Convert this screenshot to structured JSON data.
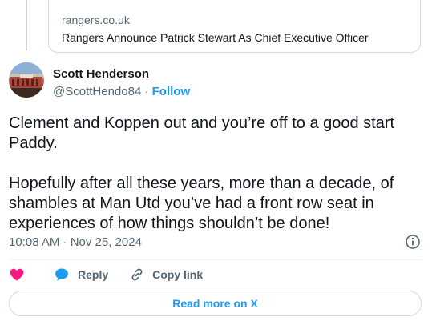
{
  "quoted_card": {
    "domain": "rangers.co.uk",
    "title": "Rangers Announce Patrick Stewart As Chief Executive Officer"
  },
  "author": {
    "name": "Scott Henderson",
    "handle": "@ScottHendo84",
    "separator": "·",
    "follow_label": "Follow"
  },
  "tweet": {
    "paragraphs": [
      "Clement and Koppen out and you’re off to a good start Paddy.",
      "Hopefully after all these years, more than a decade, of shambles at Man Utd you’ve had a front row seat in experiences of how things shouldn’t be done!"
    ],
    "timestamp": "10:08 AM · Nov 25, 2024"
  },
  "actions": {
    "reply_label": "Reply",
    "copy_label": "Copy link"
  },
  "read_more_label": "Read more on X",
  "colors": {
    "accent": "#1d9bf0",
    "heart": "#f91880",
    "muted": "#536471",
    "text": "#0f1419",
    "border": "#cfd9de"
  },
  "icons": [
    "info-icon",
    "heart-icon",
    "reply-icon",
    "link-icon"
  ]
}
